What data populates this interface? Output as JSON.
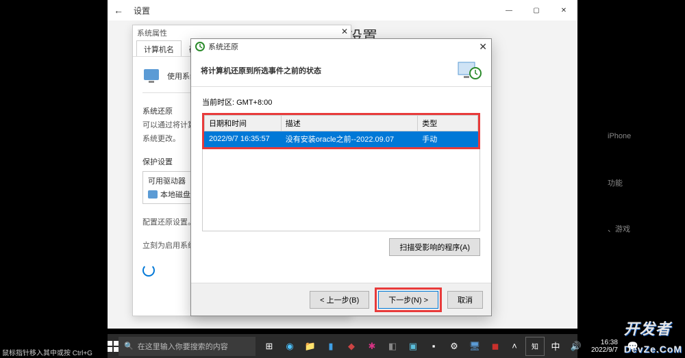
{
  "settings": {
    "title": "设置",
    "heading": "设置"
  },
  "sysprops": {
    "title": "系统属性",
    "tabs": [
      "计算机名",
      "硬件"
    ],
    "use_sys": "使用系统",
    "section_restore": "系统还原",
    "restore_desc1": "可以通过将计算机",
    "restore_desc2": "系统更改。",
    "section_protect": "保护设置",
    "drive_hdr": "可用驱动器",
    "drive_name": "本地磁盘 (C",
    "configure_text": "配置还原设置。",
    "create_text": "立刻为启用系统"
  },
  "restore": {
    "title": "系统还原",
    "header": "将计算机还原到所选事件之前的状态",
    "timezone": "当前时区: GMT+8:00",
    "cols": {
      "dt": "日期和时间",
      "desc": "描述",
      "type": "类型"
    },
    "row": {
      "dt": "2022/9/7 16:35:57",
      "desc": "没有安装oracle之前--2022.09.07",
      "type": "手动"
    },
    "scan": "扫描受影响的程序(A)",
    "back": "< 上一步(B)",
    "next": "下一步(N) >",
    "cancel": "取消"
  },
  "right": {
    "l1": "iPhone",
    "l2": "功能",
    "l3": "、游戏"
  },
  "taskbar": {
    "search_placeholder": "在这里输入你要搜索的内容",
    "clock_time": "16:38",
    "clock_date": "2022/9/7"
  },
  "watermark": "开发者\nDevZe.CoM",
  "status_bar": "鼠标指针移入其中或按 Ctrl+G"
}
